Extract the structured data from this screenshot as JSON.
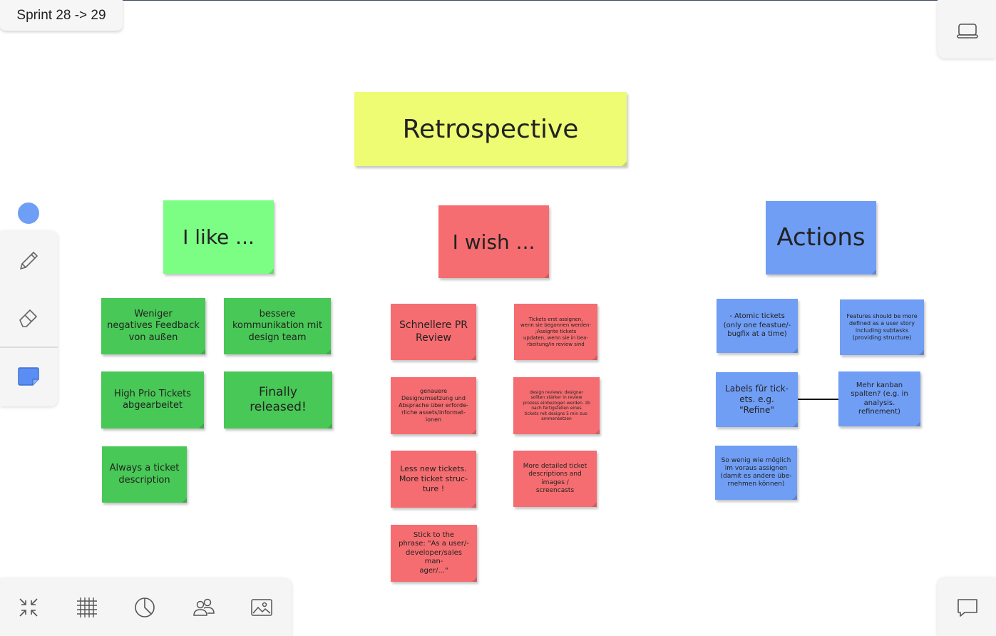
{
  "board": {
    "title": "Sprint 28 -> 29"
  },
  "toolbar": {
    "color_dot": "#6e9ef5",
    "tools": [
      {
        "name": "pen-tool",
        "icon": "pencil-icon"
      },
      {
        "name": "eraser-tool",
        "icon": "eraser-icon"
      },
      {
        "name": "sticky-note-tool",
        "icon": "sticky-note-icon"
      }
    ]
  },
  "bottom_bar": {
    "buttons": [
      {
        "name": "fit-to-screen-button",
        "icon": "collapse-arrows-icon"
      },
      {
        "name": "grid-button",
        "icon": "grid-icon"
      },
      {
        "name": "timer-button",
        "icon": "pie-timer-icon"
      },
      {
        "name": "participants-button",
        "icon": "users-icon"
      },
      {
        "name": "image-button",
        "icon": "image-icon"
      }
    ]
  },
  "right_controls": {
    "top_icon": "laptop-icon",
    "bottom_icon": "chat-bubble-icon"
  },
  "colors": {
    "yellow": "#eefc73",
    "green": "#48c856",
    "light_green": "#7cfd84",
    "red": "#f56d70",
    "blue": "#709ef5"
  },
  "notes": {
    "title": "Retrospective",
    "like_header": "I like ...",
    "wish_header": "I wish ...",
    "actions_header": "Actions",
    "like": [
      "Weniger\nnegatives Feedback\nvon außen",
      "bessere\nkommunikation mit\ndesign team",
      "High Prio Tickets\nabgearbeitet",
      "Finally\nreleased!",
      "Always a ticket\ndescription"
    ],
    "wish": [
      "Schnellere PR\nReview",
      "Tickets erst assignen,\nwenn sie begonnen werden-\n;Assignte tickets\nupdaten, wenn sie in bea-\nrbeitung/in review sind",
      "genauere\nDesignumsetzung und\nAbsprache über erforde-\nrliche assets/informat-\nionen",
      "design reviews: designer\nsollten stärker in review\nprozess einbezogen werden. zb\nnach fertigstellen eines\ntickets mit designs 5 min zus-\nammensetzen",
      "Less new tickets.\nMore ticket struc-\nture !",
      "More detailed ticket\ndescriptions and\nimages /\nscreencasts",
      "Stick to the\nphrase: \"As a user/-\ndeveloper/sales man-\nager/...\""
    ],
    "actions": [
      "- Atomic tickets\n(only one feastue/-\nbugfix at a time)",
      "Features should be more\ndefined as a user story\nincluding subtasks\n(providing structure)",
      "Labels für tick-\nets. e.g.\n\"Refine\"",
      "Mehr kanban\nspalten? (e.g. in\nanalysis.\nrefinement)",
      "So wenig wie möglich\nim voraus assignen\n(damit es andere übe-\nrnehmen können)"
    ]
  }
}
